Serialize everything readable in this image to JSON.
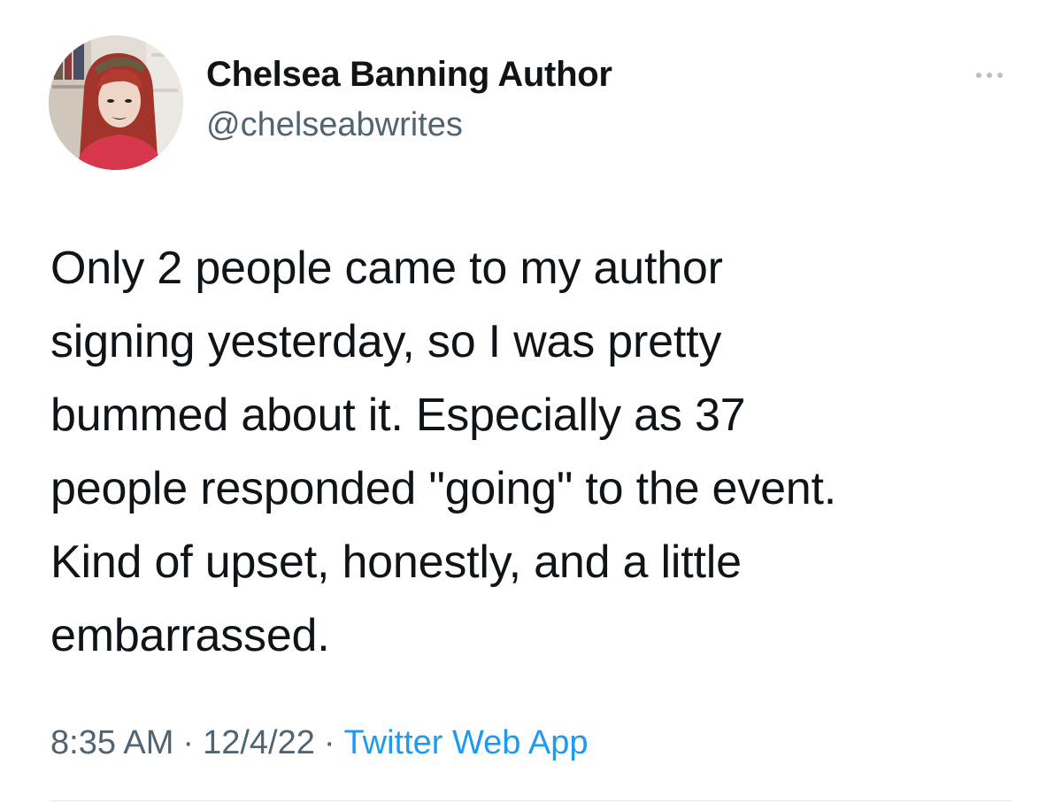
{
  "author": {
    "display_name": "Chelsea Banning Author",
    "handle": "@chelseabwrites",
    "avatar_icon": "profile-photo"
  },
  "more_icon": "more-horizontal-icon",
  "tweet": {
    "text": "Only 2 people came to my author\nsigning yesterday, so I was pretty\nbummed about it. Especially as 37\npeople responded \"going\" to the event.\nKind of upset, honestly, and a little\nembarrassed."
  },
  "meta": {
    "time": "8:35 AM",
    "separator": "·",
    "date": "12/4/22",
    "source": "Twitter Web App"
  },
  "colors": {
    "text": "#0f1419",
    "secondary": "#536471",
    "link": "#1d9bf0"
  }
}
